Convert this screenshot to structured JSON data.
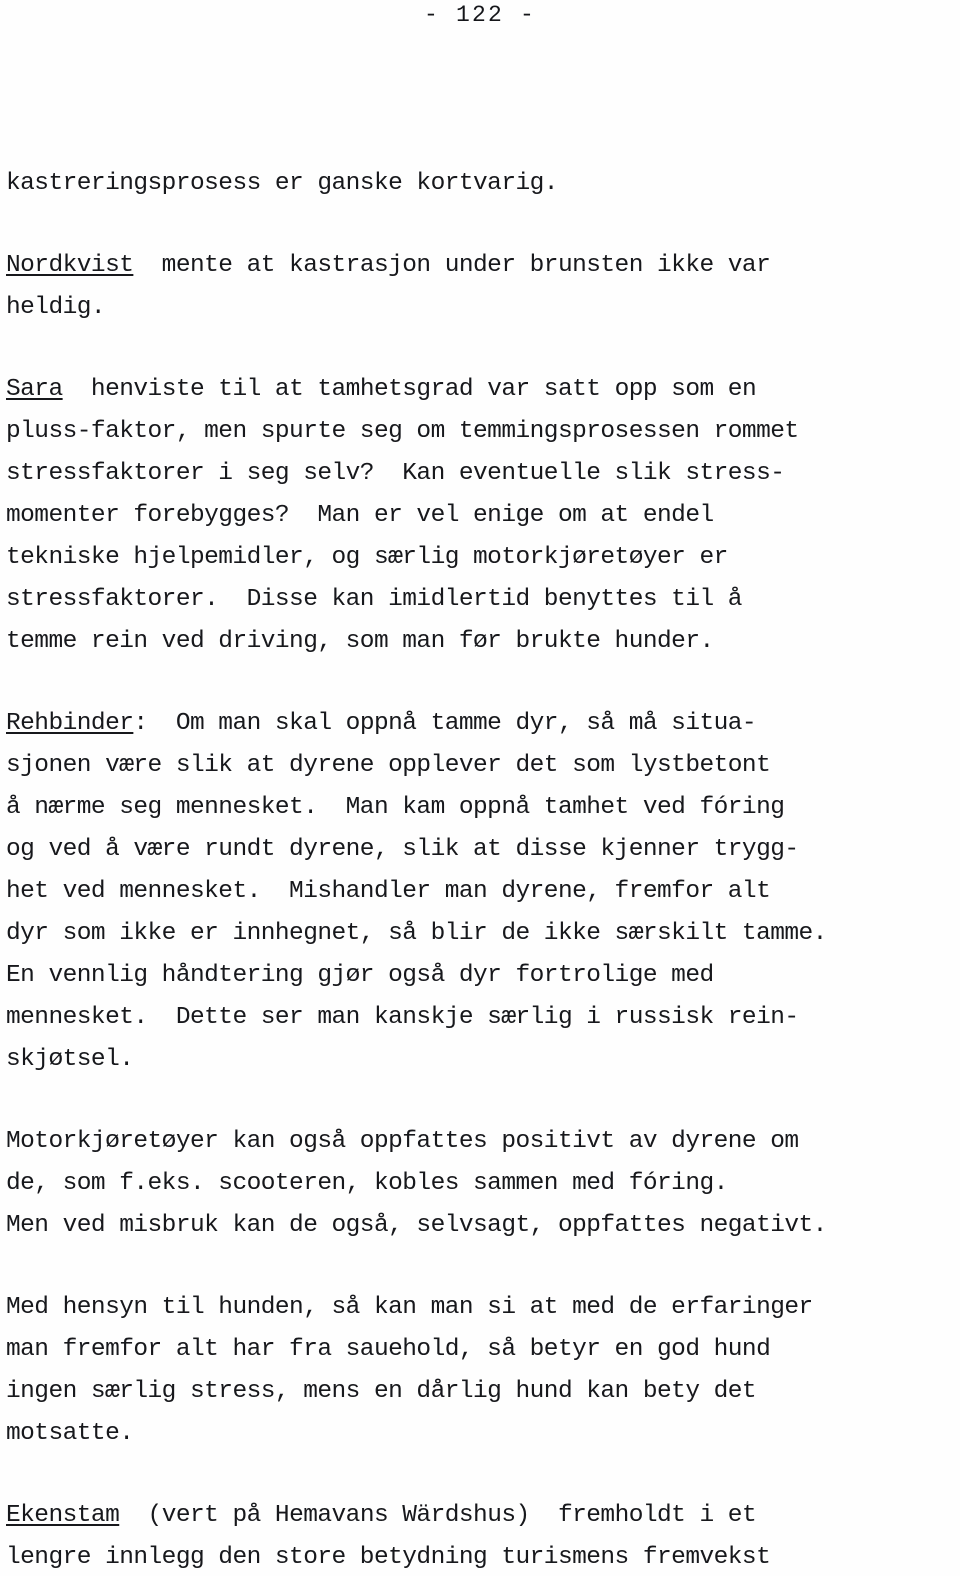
{
  "document": {
    "page_number_label": "- 122 -",
    "language": "Norwegian",
    "paragraphs": [
      {
        "id": "p1",
        "speaker": null,
        "lines": [
          {
            "text": "kastreringsprosess er ganske kortvarig."
          }
        ]
      },
      {
        "id": "p2",
        "speaker": "Nordkvist",
        "lines": [
          {
            "underline": "Nordkvist",
            "text": "  mente at kastrasjon under brunsten ikke var"
          },
          {
            "text": "heldig."
          }
        ]
      },
      {
        "id": "p3",
        "speaker": "Sara",
        "lines": [
          {
            "underline": "Sara",
            "text": "  henviste til at tamhetsgrad var satt opp som en"
          },
          {
            "text": "pluss-faktor, men spurte seg om temmingsprosessen rommet"
          },
          {
            "text": "stressfaktorer i seg selv?  Kan eventuelle slik stress-"
          },
          {
            "text": "momenter forebygges?  Man er vel enige om at endel"
          },
          {
            "text": "tekniske hjelpemidler, og særlig motorkjøretøyer er"
          },
          {
            "text": "stressfaktorer.  Disse kan imidlertid benyttes til å"
          },
          {
            "text": "temme rein ved driving, som man før brukte hunder."
          }
        ]
      },
      {
        "id": "p4",
        "speaker": "Rehbinder",
        "lines": [
          {
            "underline": "Rehbinder",
            "text": ":  Om man skal oppnå tamme dyr, så må situa-"
          },
          {
            "text": "sjonen være slik at dyrene opplever det som lystbetont"
          },
          {
            "text": "å nærme seg mennesket.  Man kam oppnå tamhet ved fóring"
          },
          {
            "text": "og ved å være rundt dyrene, slik at disse kjenner trygg-"
          },
          {
            "text": "het ved mennesket.  Mishandler man dyrene, fremfor alt"
          },
          {
            "text": "dyr som ikke er innhegnet, så blir de ikke særskilt tamme."
          },
          {
            "text": "En vennlig håndtering gjør også dyr fortrolige med"
          },
          {
            "text": "mennesket.  Dette ser man kanskje særlig i russisk rein-"
          },
          {
            "text": "skjøtsel."
          }
        ]
      },
      {
        "id": "p5",
        "speaker": null,
        "lines": [
          {
            "text": "Motorkjøretøyer kan også oppfattes positivt av dyrene om"
          },
          {
            "text": "de, som f.eks. scooteren, kobles sammen med fóring."
          },
          {
            "text": "Men ved misbruk kan de også, selvsagt, oppfattes negativt."
          }
        ]
      },
      {
        "id": "p6",
        "speaker": null,
        "lines": [
          {
            "text": "Med hensyn til hunden, så kan man si at med de erfaringer"
          },
          {
            "text": "man fremfor alt har fra sauehold, så betyr en god hund"
          },
          {
            "text": "ingen særlig stress, mens en dårlig hund kan bety det"
          },
          {
            "text": "motsatte."
          }
        ]
      },
      {
        "id": "p7",
        "speaker": "Ekenstam",
        "lines": [
          {
            "underline": "Ekenstam",
            "text": "  (vert på Hemavans Wärdshus)  fremholdt i et"
          },
          {
            "text": "lengre innlegg den store betydning turismens fremvekst"
          }
        ]
      }
    ]
  },
  "colors": {
    "ink": "#17181c",
    "paper": "#fefefe"
  }
}
